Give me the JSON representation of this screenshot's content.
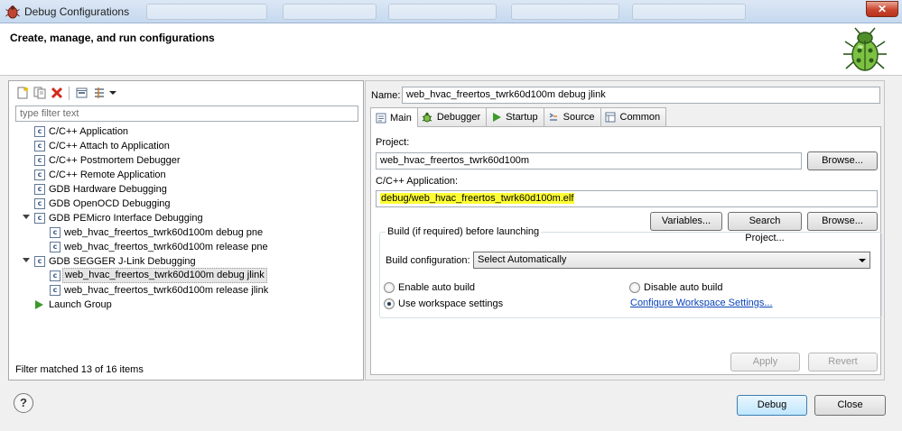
{
  "window": {
    "title": "Debug Configurations",
    "close_glyph": "✕"
  },
  "header": {
    "heading": "Create, manage, and run configurations",
    "logo_icon": "bug-icon"
  },
  "left": {
    "toolbar_icons": [
      "new-configuration-icon",
      "duplicate-icon",
      "delete-icon",
      "collapse-all-icon",
      "filter-icon",
      "dropdown-arrow-icon"
    ],
    "filter_placeholder": "type filter text",
    "tree": [
      {
        "label": "C/C++ Application",
        "level": 1,
        "expanded": false,
        "icon": "c-config-icon"
      },
      {
        "label": "C/C++ Attach to Application",
        "level": 1,
        "expanded": false,
        "icon": "c-config-icon"
      },
      {
        "label": "C/C++ Postmortem Debugger",
        "level": 1,
        "expanded": false,
        "icon": "c-config-icon"
      },
      {
        "label": "C/C++ Remote Application",
        "level": 1,
        "expanded": false,
        "icon": "c-config-icon"
      },
      {
        "label": "GDB Hardware Debugging",
        "level": 1,
        "expanded": false,
        "icon": "c-config-icon"
      },
      {
        "label": "GDB OpenOCD Debugging",
        "level": 1,
        "expanded": false,
        "icon": "c-config-icon"
      },
      {
        "label": "GDB PEMicro Interface Debugging",
        "level": 1,
        "expanded": true,
        "icon": "c-config-icon"
      },
      {
        "label": "web_hvac_freertos_twrk60d100m debug pne",
        "level": 2,
        "expanded": false,
        "icon": "c-config-icon"
      },
      {
        "label": "web_hvac_freertos_twrk60d100m release pne",
        "level": 2,
        "expanded": false,
        "icon": "c-config-icon"
      },
      {
        "label": "GDB SEGGER J-Link Debugging",
        "level": 1,
        "expanded": true,
        "icon": "c-config-icon"
      },
      {
        "label": "web_hvac_freertos_twrk60d100m debug jlink",
        "level": 2,
        "expanded": false,
        "icon": "c-config-icon",
        "selected": true
      },
      {
        "label": "web_hvac_freertos_twrk60d100m release jlink",
        "level": 2,
        "expanded": false,
        "icon": "c-config-icon"
      },
      {
        "label": "Launch Group",
        "level": 1,
        "expanded": false,
        "icon": "launch-group-icon"
      }
    ],
    "status": "Filter matched 13 of 16 items"
  },
  "right": {
    "name_label": "Name:",
    "name_value": "web_hvac_freertos_twrk60d100m debug jlink",
    "tabs": [
      {
        "label": "Main",
        "icon": "main-tab-icon",
        "active": true
      },
      {
        "label": "Debugger",
        "icon": "debugger-tab-icon",
        "active": false
      },
      {
        "label": "Startup",
        "icon": "startup-tab-icon",
        "active": false
      },
      {
        "label": "Source",
        "icon": "source-tab-icon",
        "active": false
      },
      {
        "label": "Common",
        "icon": "common-tab-icon",
        "active": false
      }
    ],
    "main": {
      "project_label": "Project:",
      "project_value": "web_hvac_freertos_twrk60d100m",
      "browse_label": "Browse...",
      "app_label": "C/C++ Application:",
      "app_value": "debug/web_hvac_freertos_twrk60d100m.elf",
      "highlight_color": "#ffff33",
      "variables_label": "Variables...",
      "search_project_label": "Search Project...",
      "browse2_label": "Browse...",
      "build_group_title": "Build (if required) before launching",
      "build_config_label": "Build configuration:",
      "build_config_value": "Select Automatically",
      "enable_auto_build": "Enable auto build",
      "disable_auto_build": "Disable auto build",
      "use_workspace": "Use workspace settings",
      "configure_link": "Configure Workspace Settings...",
      "selected_radio": "use_workspace"
    },
    "apply_label": "Apply",
    "revert_label": "Revert"
  },
  "footer": {
    "help_glyph": "?",
    "debug_label": "Debug",
    "close_label": "Close"
  }
}
